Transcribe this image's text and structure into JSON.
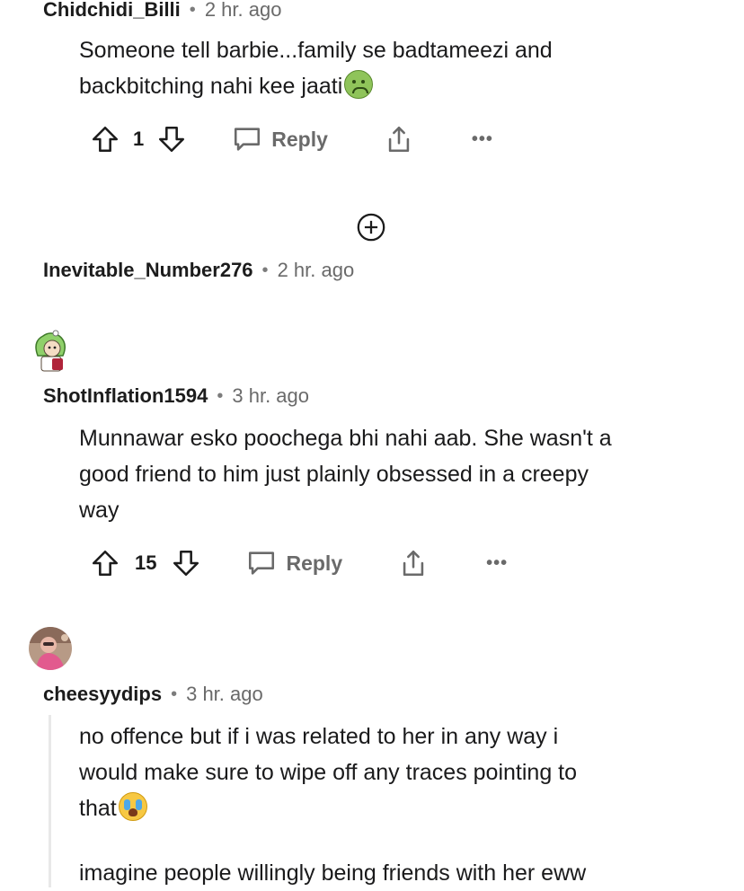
{
  "comments": [
    {
      "username": "Chidchidi_Billi",
      "time": "2 hr. ago",
      "lines": [
        "Someone tell barbie...family se badtameezi and",
        "backbitching nahi kee jaati"
      ],
      "votes": "1",
      "reply_label": "Reply",
      "more": "•••"
    },
    {
      "username": "Inevitable_Number276",
      "time": "2 hr. ago"
    },
    {
      "username": "ShotInflation1594",
      "time": "3 hr. ago",
      "lines": [
        "Munnawar esko poochega bhi nahi aab. She wasn't a",
        "good friend to him just plainly obsessed in a creepy",
        "way"
      ],
      "votes": "15",
      "reply_label": "Reply",
      "more": "•••"
    },
    {
      "username": "cheesyydips",
      "time": "3 hr. ago",
      "lines": [
        "no offence but if i was related to her in any way i",
        "would make sure to wipe off any traces pointing to",
        "that",
        "imagine people willingly being friends with her eww"
      ]
    }
  ],
  "meta_dot": "•",
  "icons": {
    "upvote": "upvote-arrow-icon",
    "downvote": "downvote-arrow-icon",
    "reply": "speech-bubble-icon",
    "share": "share-icon",
    "expand": "plus-circle-icon"
  },
  "colors": {
    "text": "#1a1a1b",
    "muted": "#6a6a6a",
    "avatar_green": "#8fd06a",
    "avatar_brown": "#8a5a44"
  }
}
